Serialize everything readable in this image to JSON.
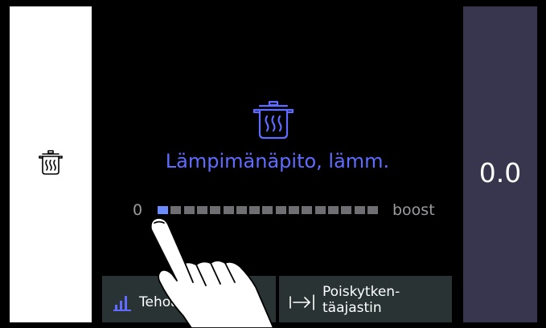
{
  "left_panel": {
    "icon": "cooking-pot-icon"
  },
  "center": {
    "icon": "cooking-pot-icon",
    "mode_title": "Lämpimänäpito, lämm.",
    "scale_min_label": "0",
    "scale_max_label": "boost",
    "power_level": {
      "current": 1,
      "total_steps": 17
    }
  },
  "right_panel": {
    "value": "0.0"
  },
  "bottom_buttons": {
    "power": {
      "icon": "bar-chart-icon",
      "label": "Tehoa"
    },
    "timer": {
      "icon": "arrow-to-bar-icon",
      "label_line1": "Poiskytken-",
      "label_line2": "täajastin"
    }
  },
  "overlay": {
    "icon": "touch-hand-icon"
  },
  "colors": {
    "accent": "#5f6cff",
    "active_segment": "#6b8cff",
    "inactive_segment": "#6f6f73",
    "right_panel_bg": "#38364f",
    "button_bg": "#2a3333"
  }
}
